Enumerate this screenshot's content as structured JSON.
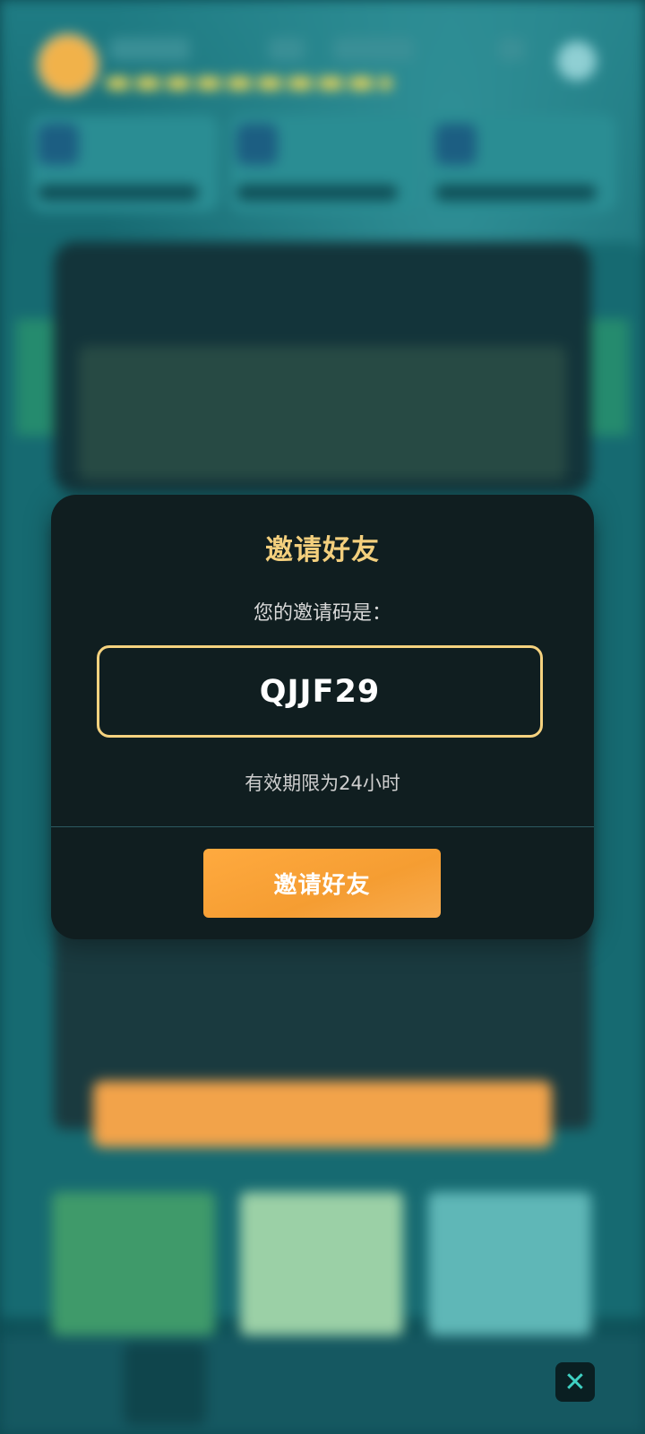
{
  "dialog": {
    "title": "邀请好友",
    "subtitle": "您的邀请码是：",
    "invite_code": "QJJF29",
    "validity": "有效期限为24小时",
    "invite_button_label": "邀请好友"
  },
  "close_button": {
    "icon": "close-icon",
    "glyph": "✕"
  },
  "colors": {
    "title": "#f3cf7d",
    "code_border": "#f5d27f",
    "button": "#f59d32",
    "modal_bg": "#101e20"
  }
}
